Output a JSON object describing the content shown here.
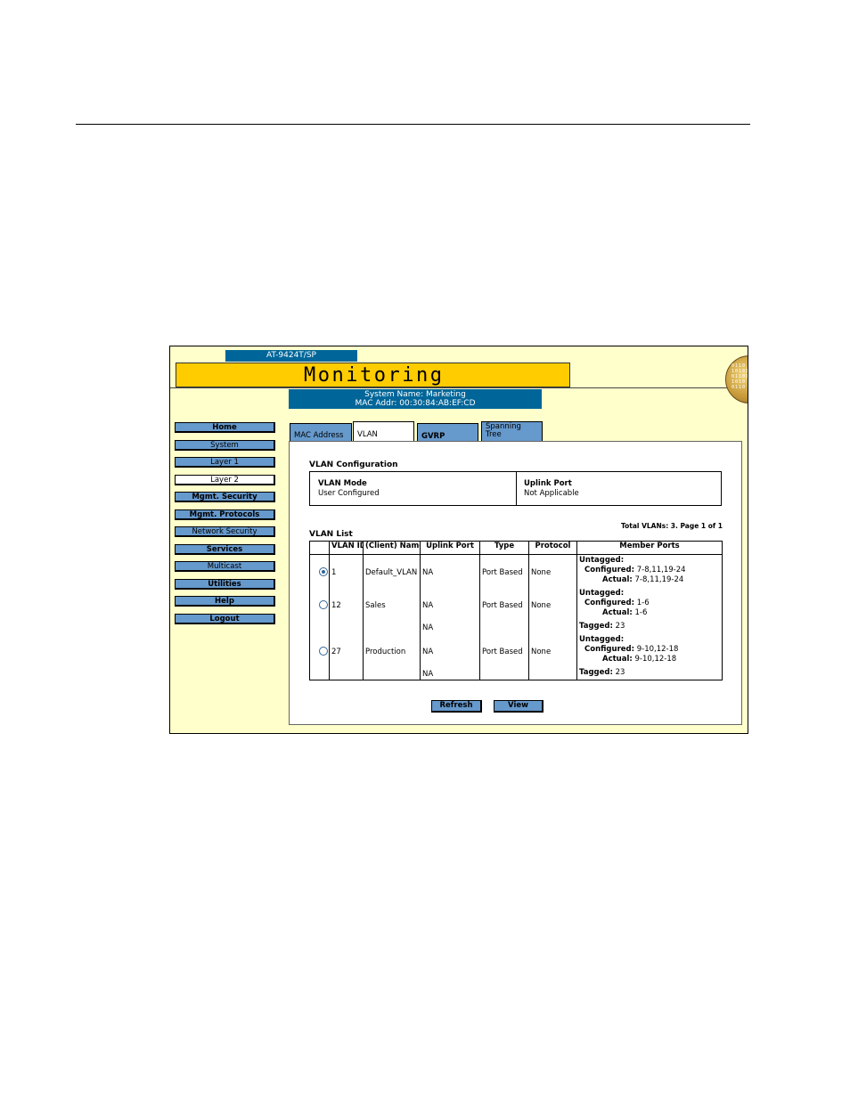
{
  "header": {
    "model": "AT-9424T/SP",
    "title": "Monitoring",
    "system_name": "System Name: Marketing",
    "mac_addr": "MAC Addr: 00:30:84:AB:EF:CD"
  },
  "sidebar": {
    "items": [
      {
        "label": "Home"
      },
      {
        "label": "System"
      },
      {
        "label": "Layer 1"
      },
      {
        "label": "Layer 2"
      },
      {
        "label": "Mgmt. Security"
      },
      {
        "label": "Mgmt. Protocols"
      },
      {
        "label": "Network Security"
      },
      {
        "label": "Services"
      },
      {
        "label": "Multicast"
      },
      {
        "label": "Utilities"
      },
      {
        "label": "Help"
      },
      {
        "label": "Logout"
      }
    ],
    "active": "Layer 2"
  },
  "tabs": [
    {
      "label": "MAC Address"
    },
    {
      "label": "VLAN"
    },
    {
      "label": "GVRP"
    },
    {
      "label_line1": "Spanning",
      "label_line2": "Tree"
    }
  ],
  "vlan_config": {
    "title": "VLAN Configuration",
    "mode_label": "VLAN Mode",
    "mode_value": "User Configured",
    "uplink_label": "Uplink Port",
    "uplink_value": "Not Applicable"
  },
  "vlan_list": {
    "title": "VLAN List",
    "total": "Total VLANs: 3. Page 1 of 1",
    "columns": [
      "",
      "VLAN ID",
      "(Client) Name",
      "Uplink Port",
      "Type",
      "Protocol",
      "Member Ports"
    ],
    "rows": [
      {
        "selected": true,
        "id": "1",
        "name": "Default_VLAN",
        "uplink": "NA",
        "type": "Port Based",
        "protocol": "None",
        "untagged": "Untagged:",
        "configured_label": "Configured:",
        "configured": "7-8,11,19-24",
        "actual_label": "Actual:",
        "actual": "7-8,11,19-24"
      },
      {
        "selected": false,
        "id": "12",
        "name": "Sales",
        "uplink": "NA",
        "uplink2": "NA",
        "type": "Port Based",
        "protocol": "None",
        "untagged": "Untagged:",
        "configured_label": "Configured:",
        "configured": "1-6",
        "actual_label": "Actual:",
        "actual": "1-6",
        "tagged_label": "Tagged:",
        "tagged": "23"
      },
      {
        "selected": false,
        "id": "27",
        "name": "Production",
        "uplink": "NA",
        "uplink2": "NA",
        "type": "Port Based",
        "protocol": "None",
        "untagged": "Untagged:",
        "configured_label": "Configured:",
        "configured": "9-10,12-18",
        "actual_label": "Actual:",
        "actual": "9-10,12-18",
        "tagged_label": "Tagged:",
        "tagged": "23"
      }
    ]
  },
  "buttons": {
    "refresh": "Refresh",
    "view": "View"
  },
  "colors": {
    "accent": "#006699",
    "banner": "#ffcc00",
    "button": "#6699cc",
    "background": "#ffffcc"
  }
}
